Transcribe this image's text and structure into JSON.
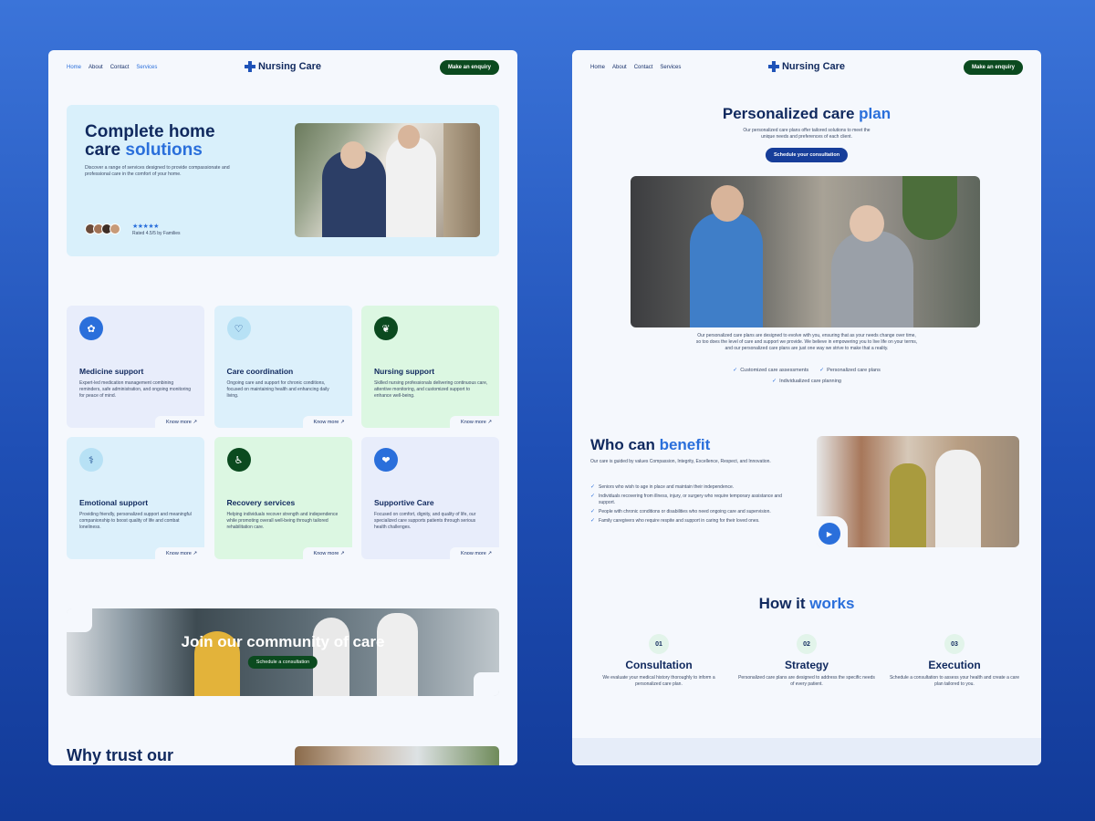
{
  "nav": {
    "links": [
      "Home",
      "About",
      "Contact",
      "Services"
    ],
    "logo": "Nursing Care",
    "cta": "Make an enquiry"
  },
  "hero": {
    "title_line1": "Complete home",
    "title_line2_plain": "care ",
    "title_line2_accent": "solutions",
    "description": "Discover a range of services designed to provide compassionate and professional care in the comfort of your home.",
    "stars": "★★★★★",
    "rating_text": "Rated 4.5/5 by Families"
  },
  "services": [
    {
      "title": "Medicine support",
      "desc": "Expert-led medication management combining reminders, safe administration, and ongoing monitoring for peace of mind.",
      "icon": "pill-icon",
      "glyph": "✿",
      "link": "Know more"
    },
    {
      "title": "Care coordination",
      "desc": "Ongoing care and support for chronic conditions, focused on maintaining health and enhancing daily living.",
      "icon": "heart-hand-icon",
      "glyph": "♡",
      "link": "Know more"
    },
    {
      "title": "Nursing support",
      "desc": "Skilled nursing professionals delivering continuous care, attentive monitoring, and customized support to enhance well-being.",
      "icon": "lungs-icon",
      "glyph": "❦",
      "link": "Know more"
    },
    {
      "title": "Emotional support",
      "desc": "Providing friendly, personalized support and meaningful companionship to boost quality of life and combat loneliness.",
      "icon": "stethoscope-icon",
      "glyph": "⚕",
      "link": "Know more"
    },
    {
      "title": "Recovery services",
      "desc": "Helping individuals recover strength and independence while promoting overall well-being through tailored rehabilitation care.",
      "icon": "wheelchair-icon",
      "glyph": "♿",
      "link": "Know more"
    },
    {
      "title": "Supportive Care",
      "desc": "Focused on comfort, dignity, and quality of life, our specialized care supports patients through serious health challenges.",
      "icon": "care-hands-icon",
      "glyph": "❤",
      "link": "Know more"
    }
  ],
  "join": {
    "title": "Join our community of care",
    "cta": "Schedule a consultation"
  },
  "why": {
    "title": "Why trust our"
  },
  "plan": {
    "title_plain": "Personalized care ",
    "title_accent": "plan",
    "subtitle": "Our personalized care plans offer tailored solutions to meet the unique needs and preferences of each client.",
    "cta": "Schedule your consultation",
    "description": "Our personalized care plans are designed to evolve with you, ensuring that as your needs change over time, so too does the level of care and support we provide. We believe in empowering you to live life on your terms, and our personalized care plans are just one way we strive to make that a reality.",
    "checks": [
      "Customized care assessments",
      "Personalized care plans",
      "Individualized care planning"
    ]
  },
  "benefit": {
    "title_plain": "Who can ",
    "title_accent": "benefit",
    "subtitle": "Our care is guided by values Compassion, Integrity, Excellence, Respect, and Innovation.",
    "items": [
      "Seniors who wish to age in place and maintain their independence.",
      "Individuals recovering from illness, injury, or surgery who require temporary assistance and support.",
      "People with chronic conditions or disabilities who need ongoing care and supervision.",
      "Family caregivers who require respite and support in caring for their loved ones."
    ]
  },
  "how": {
    "title_plain": "How it ",
    "title_accent": "works",
    "steps": [
      {
        "num": "01",
        "title": "Consultation",
        "desc": "We evaluate your medical history thoroughly to inform a personalized care plan."
      },
      {
        "num": "02",
        "title": "Strategy",
        "desc": "Personalized care plans are designed to address the specific needs of every patient."
      },
      {
        "num": "03",
        "title": "Execution",
        "desc": "Schedule a consultation to assess your health and create a care plan tailored to you."
      }
    ]
  },
  "colors": {
    "brand_dark": "#10295e",
    "accent_blue": "#2a6fdb",
    "cta_green": "#0b4a1f",
    "cta_navy": "#173e9a"
  }
}
